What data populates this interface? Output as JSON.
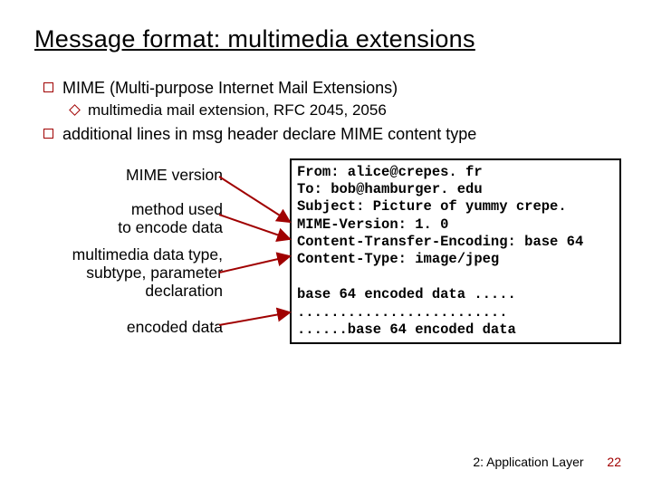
{
  "title": "Message format: multimedia extensions",
  "bullets": {
    "b1a": "MIME (Multi-purpose Internet Mail Extensions)",
    "b2a": "multimedia mail extension, RFC 2045, 2056",
    "b1b": "additional lines in msg header declare MIME content type"
  },
  "labels": {
    "l1": "MIME version",
    "l2": "method used\nto encode data",
    "l3": "multimedia data type, subtype, parameter declaration",
    "l4": "encoded data"
  },
  "msg": {
    "m1": "From: alice@crepes. fr",
    "m2": "To: bob@hamburger. edu",
    "m3": "Subject: Picture of yummy crepe.",
    "m4": "MIME-Version: 1. 0",
    "m5": "Content-Transfer-Encoding: base 64",
    "m6": "Content-Type: image/jpeg",
    "m7": " ",
    "m8": "base 64 encoded data .....",
    "m9": ".........................",
    "m10": "......base 64 encoded data"
  },
  "footer": {
    "section": "2: Application Layer",
    "page": "22"
  }
}
